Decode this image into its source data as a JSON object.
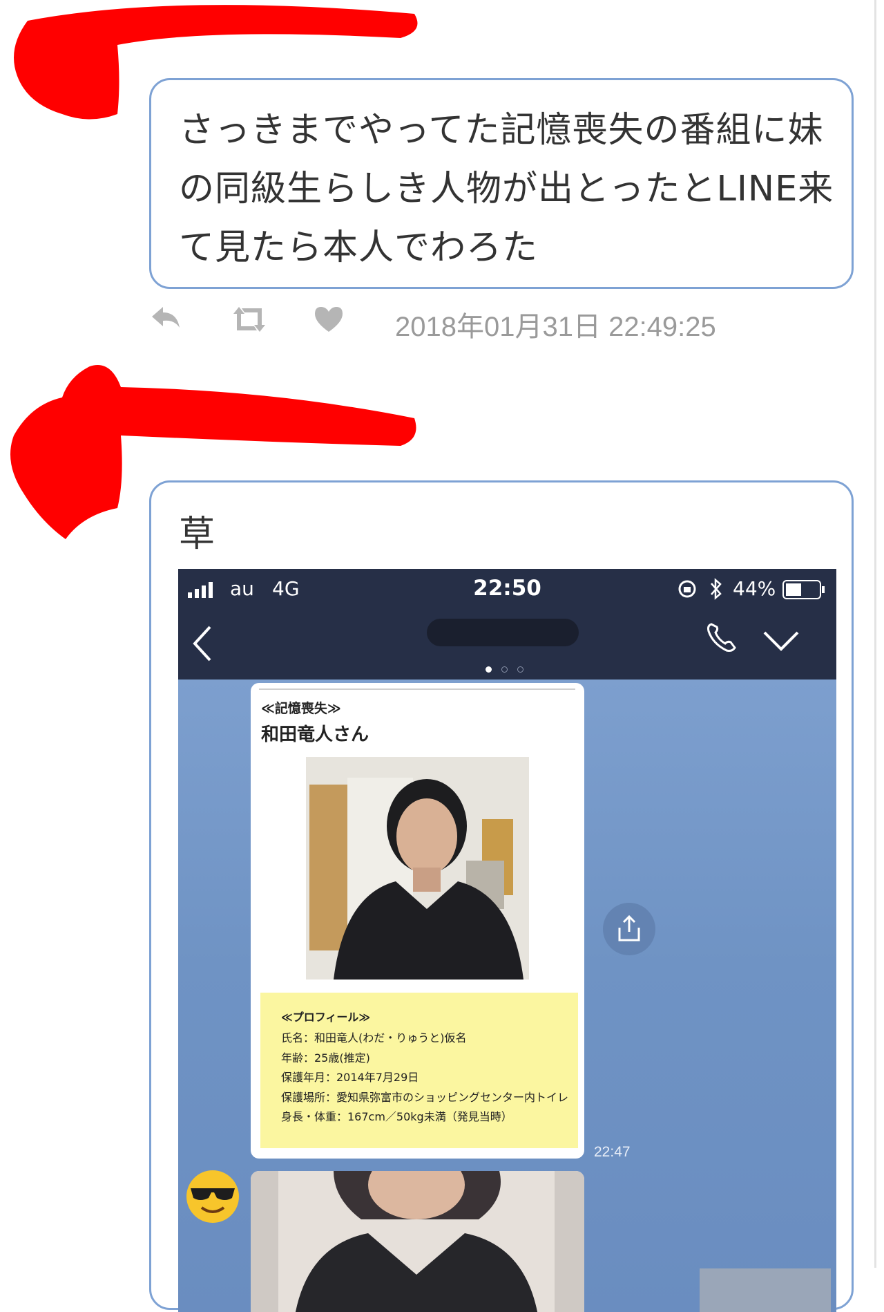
{
  "tweets": [
    {
      "text": "さっきまでやってた記憶喪失の番組に妹の同級生らしき人物が出とったとLINE来て見たら本人でわろた",
      "timestamp": "2018年01月31日 22:49:25",
      "actions": [
        "reply-icon",
        "retweet-icon",
        "heart-icon"
      ]
    },
    {
      "text": "草",
      "attachment": {
        "status_bar": {
          "carrier": "au",
          "network": "4G",
          "time": "22:50",
          "battery": "44%",
          "icons": [
            "signal-icon",
            "rotation-lock-icon",
            "bluetooth-icon",
            "battery-icon"
          ]
        },
        "nav_icons": [
          "back-chevron-icon",
          "phone-icon",
          "chevron-down-icon"
        ],
        "card": {
          "tag": "≪記憶喪失≫",
          "name": "和田竜人さん",
          "profile_title": "≪プロフィール≫",
          "profile_lines": [
            "氏名：和田竜人(わだ・りゅうと)仮名",
            "年齢：25歳(推定)",
            "保護年月：2014年7月29日",
            "保護場所：愛知県弥富市のショッピングセンター内トイレ",
            "身長・体重：167cm／50kg未満（発見当時）"
          ]
        },
        "message_time": "22:47",
        "share_icon": "share-icon",
        "avatar": "sunglasses-emoji-icon"
      }
    }
  ],
  "colors": {
    "bubble_border": "#7ea2d4",
    "redaction": "#ff0000",
    "line_header": "#262f47",
    "chat_background": "#6f93c4",
    "profile_background": "#fbf6a0"
  }
}
